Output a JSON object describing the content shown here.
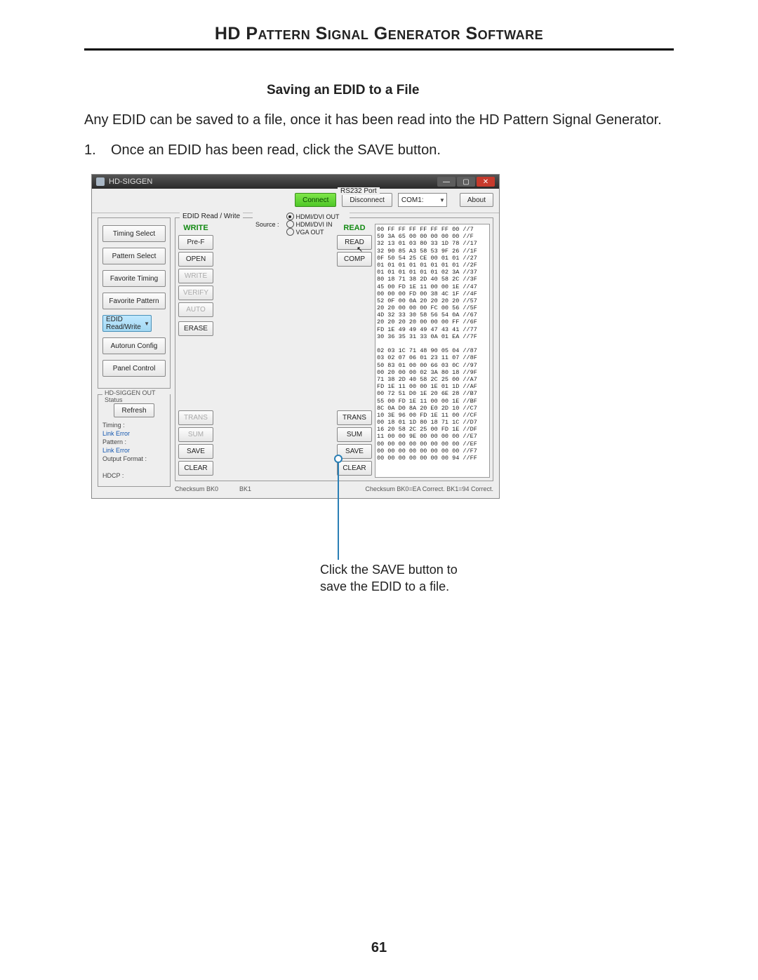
{
  "doc": {
    "title": "HD Pattern Signal Generator Software",
    "section_title": "Saving an EDID to a File",
    "intro": "Any EDID can be saved to a file, once it has been read into the HD Pattern Signal Generator.",
    "step_num": "1.",
    "step_text": "Once an EDID has been read, click the SAVE button.",
    "callout": "Click the SAVE button to save the EDID to a file.",
    "page_number": "61"
  },
  "app": {
    "title": "HD-SIGGEN",
    "rs232_label": "RS232 Port",
    "connect": "Connect",
    "disconnect": "Disconnect",
    "com_value": "COM1:",
    "about": "About",
    "edid_group": "EDID Read / Write",
    "source_label": "Source :",
    "source_options": [
      "HDMI/DVI OUT",
      "HDMI/DVI IN",
      "VGA OUT"
    ],
    "source_selected": 0,
    "write_hdr": "WRITE",
    "read_hdr": "READ",
    "write_buttons": [
      "Pre-F",
      "OPEN",
      "WRITE",
      "VERIFY",
      "AUTO",
      "ERASE"
    ],
    "write_disabled": [
      false,
      false,
      true,
      true,
      true,
      false
    ],
    "write_lower": [
      "TRANS",
      "SUM",
      "SAVE",
      "CLEAR"
    ],
    "write_lower_disabled": [
      true,
      true,
      false,
      false
    ],
    "read_buttons": [
      "READ",
      "COMP"
    ],
    "read_lower": [
      "TRANS",
      "SUM",
      "SAVE",
      "CLEAR"
    ],
    "checksum_left": "Checksum BK0",
    "checksum_bk1": "BK1",
    "checksum_right": "Checksum BK0=EA Correct.     BK1=94 Correct.",
    "side_buttons": [
      "Timing Select",
      "Pattern Select",
      "Favorite Timing",
      "Favorite Pattern",
      "EDID Read/Write",
      "Autorun Config",
      "Panel Control"
    ],
    "side_selected": 4,
    "out_status_label": "HD-SIGGEN OUT Status",
    "refresh": "Refresh",
    "status_timing": "Timing :",
    "status_pattern": "Pattern :",
    "status_output": "Output Format :",
    "status_hdcp": "HDCP :",
    "link_error": "Link Error",
    "hex_dump": "00 FF FF FF FF FF FF 00 //7\n59 3A 65 00 00 00 00 00 //F\n32 13 01 03 80 33 1D 78 //17\n32 90 85 A3 58 53 9F 26 //1F\n0F 50 54 25 CE 00 01 01 //27\n01 01 01 01 01 01 01 01 //2F\n01 01 01 01 01 01 02 3A //37\n80 18 71 38 2D 40 58 2C //3F\n45 00 FD 1E 11 00 00 1E //47\n00 00 00 FD 00 38 4C 1F //4F\n52 0F 00 0A 20 20 20 20 //57\n20 20 00 00 00 FC 00 56 //5F\n4D 32 33 30 58 56 54 0A //67\n20 20 20 20 00 00 00 FF //6F\nFD 1E 49 49 49 47 43 41 //77\n30 36 35 31 33 0A 01 EA //7F\n\n02 03 1C 71 48 90 05 04 //87\n03 02 07 06 01 23 11 07 //8F\n50 83 01 00 00 66 03 0C //97\n00 20 00 00 02 3A 80 18 //9F\n71 38 2D 40 58 2C 25 00 //A7\nFD 1E 11 00 00 1E 01 1D //AF\n00 72 51 D0 1E 20 6E 28 //B7\n55 00 FD 1E 11 00 00 1E //BF\n8C 0A D0 8A 20 E0 2D 10 //C7\n10 3E 96 00 FD 1E 11 00 //CF\n00 18 01 1D 80 18 71 1C //D7\n16 20 58 2C 25 00 FD 1E //DF\n11 00 00 9E 00 00 00 00 //E7\n00 00 00 00 00 00 00 00 //EF\n00 00 00 00 00 00 00 00 //F7\n00 00 00 00 00 00 00 94 //FF"
  }
}
